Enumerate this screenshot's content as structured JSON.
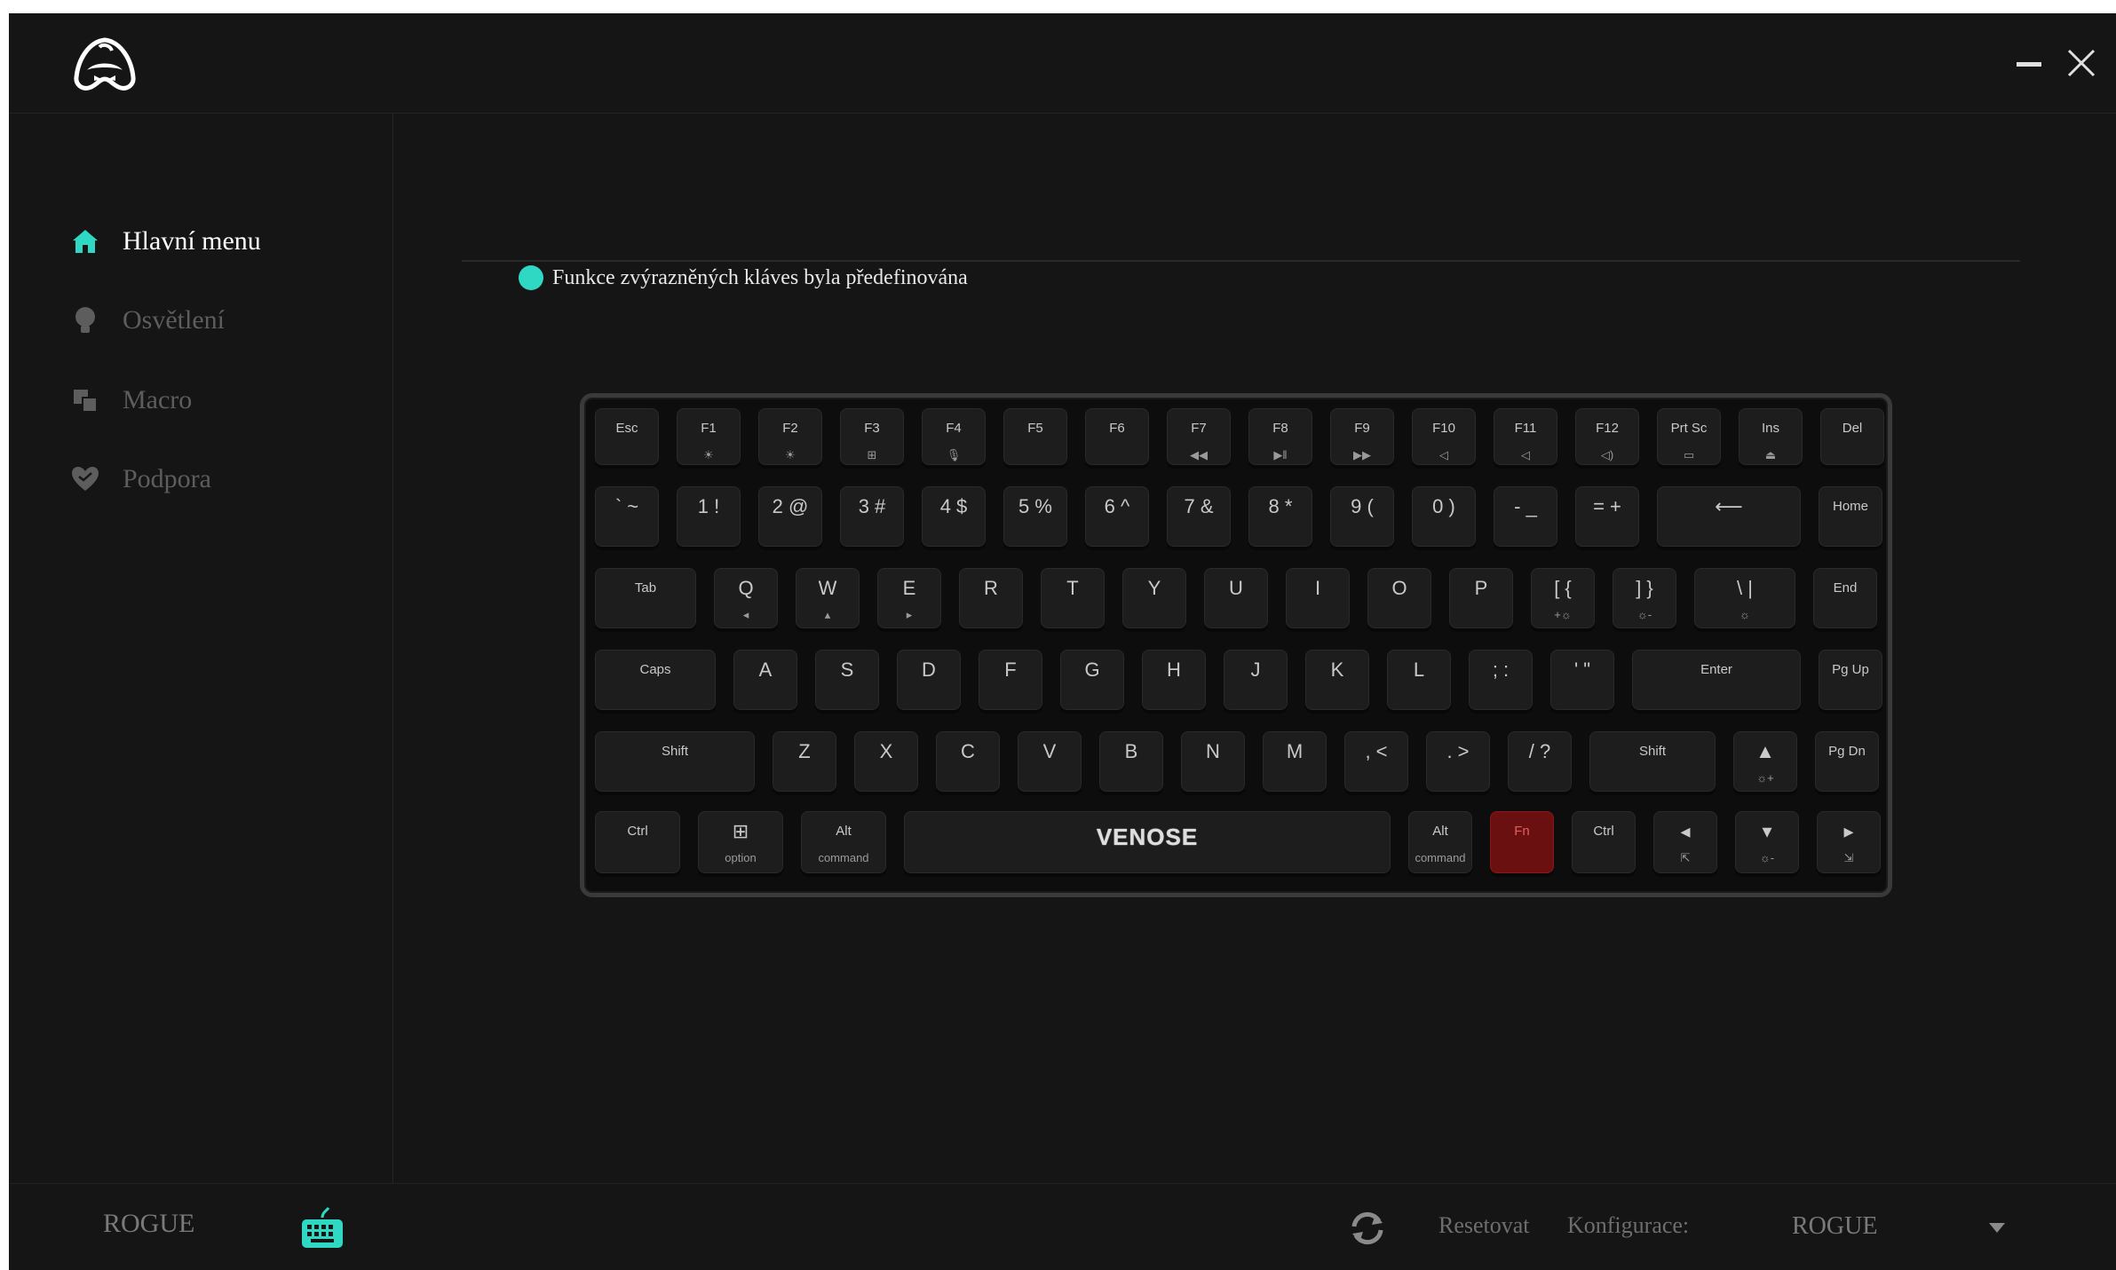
{
  "sidebar": {
    "items": [
      {
        "label": "Hlavní menu",
        "icon": "home-icon",
        "active": true
      },
      {
        "label": "Osvětlení",
        "icon": "bulb-icon",
        "active": false
      },
      {
        "label": "Macro",
        "icon": "macro-icon",
        "active": false
      },
      {
        "label": "Podpora",
        "icon": "heart-icon",
        "active": false
      }
    ]
  },
  "main": {
    "notice": "Funkce zvýrazněných kláves byla předefinována",
    "accent_color": "#2ed8c3"
  },
  "keyboard": {
    "space_logo": "VENOSE",
    "fn_color": "#6a1010",
    "keys": [
      {
        "t": "Esc",
        "b": ""
      },
      {
        "t": "F1",
        "b": "☀"
      },
      {
        "t": "F2",
        "b": "☀"
      },
      {
        "t": "F3",
        "b": "⊞"
      },
      {
        "t": "F4",
        "b": "🎙"
      },
      {
        "t": "F5",
        "b": ""
      },
      {
        "t": "F6",
        "b": ""
      },
      {
        "t": "F7",
        "b": "◀◀"
      },
      {
        "t": "F8",
        "b": "▶‖"
      },
      {
        "t": "F9",
        "b": "▶▶"
      },
      {
        "t": "F10",
        "b": "◁"
      },
      {
        "t": "F11",
        "b": "◁"
      },
      {
        "t": "F12",
        "b": "◁)"
      },
      {
        "t": "Prt Sc",
        "b": "▭"
      },
      {
        "t": "Ins",
        "b": "⏏"
      },
      {
        "t": "Del",
        "b": ""
      },
      {
        "t": "` ~",
        "b": ""
      },
      {
        "t": "1 !",
        "b": ""
      },
      {
        "t": "2 @",
        "b": ""
      },
      {
        "t": "3 #",
        "b": ""
      },
      {
        "t": "4 $",
        "b": ""
      },
      {
        "t": "5 %",
        "b": ""
      },
      {
        "t": "6 ^",
        "b": ""
      },
      {
        "t": "7 &",
        "b": ""
      },
      {
        "t": "8 *",
        "b": ""
      },
      {
        "t": "9 (",
        "b": ""
      },
      {
        "t": "0 )",
        "b": ""
      },
      {
        "t": "- _",
        "b": ""
      },
      {
        "t": "= +",
        "b": ""
      },
      {
        "t": "⟵",
        "b": ""
      },
      {
        "t": "Home",
        "b": ""
      },
      {
        "t": "Tab",
        "b": ""
      },
      {
        "t": "Q",
        "b": "◂"
      },
      {
        "t": "W",
        "b": "▴"
      },
      {
        "t": "E",
        "b": "▸"
      },
      {
        "t": "R",
        "b": ""
      },
      {
        "t": "T",
        "b": ""
      },
      {
        "t": "Y",
        "b": ""
      },
      {
        "t": "U",
        "b": ""
      },
      {
        "t": "I",
        "b": ""
      },
      {
        "t": "O",
        "b": ""
      },
      {
        "t": "P",
        "b": ""
      },
      {
        "t": "[ {",
        "b": "+☼"
      },
      {
        "t": "] }",
        "b": "☼-"
      },
      {
        "t": "\\ |",
        "b": "☼"
      },
      {
        "t": "End",
        "b": ""
      },
      {
        "t": "Caps",
        "b": ""
      },
      {
        "t": "A",
        "b": ""
      },
      {
        "t": "S",
        "b": ""
      },
      {
        "t": "D",
        "b": ""
      },
      {
        "t": "F",
        "b": ""
      },
      {
        "t": "G",
        "b": ""
      },
      {
        "t": "H",
        "b": ""
      },
      {
        "t": "J",
        "b": ""
      },
      {
        "t": "K",
        "b": ""
      },
      {
        "t": "L",
        "b": ""
      },
      {
        "t": "; :",
        "b": ""
      },
      {
        "t": "' \"",
        "b": ""
      },
      {
        "t": "Enter",
        "b": ""
      },
      {
        "t": "Pg Up",
        "b": ""
      },
      {
        "t": "Shift",
        "b": ""
      },
      {
        "t": "Z",
        "b": ""
      },
      {
        "t": "X",
        "b": ""
      },
      {
        "t": "C",
        "b": ""
      },
      {
        "t": "V",
        "b": ""
      },
      {
        "t": "B",
        "b": ""
      },
      {
        "t": "N",
        "b": ""
      },
      {
        "t": "M",
        "b": ""
      },
      {
        "t": ", <",
        "b": ""
      },
      {
        "t": ". >",
        "b": ""
      },
      {
        "t": "/ ?",
        "b": ""
      },
      {
        "t": "Shift",
        "b": ""
      },
      {
        "t": "▲",
        "b": "☼+"
      },
      {
        "t": "Pg Dn",
        "b": ""
      },
      {
        "t": "Ctrl",
        "b": ""
      },
      {
        "t": "⊞",
        "b": "option"
      },
      {
        "t": "Alt",
        "b": "command"
      },
      {
        "t": "",
        "b": ""
      },
      {
        "t": "Alt",
        "b": "command"
      },
      {
        "t": "Fn",
        "b": ""
      },
      {
        "t": "Ctrl",
        "b": ""
      },
      {
        "t": "◂",
        "b": "⇱"
      },
      {
        "t": "▾",
        "b": "☼-"
      },
      {
        "t": "▸",
        "b": "⇲"
      }
    ]
  },
  "footer": {
    "profile_name": "ROGUE",
    "keyboard_icon": "keyboard-icon",
    "refresh_icon": "refresh-icon",
    "reset_label": "Resetovat",
    "config_label": "Konfigurace:",
    "config_value": "ROGUE"
  }
}
